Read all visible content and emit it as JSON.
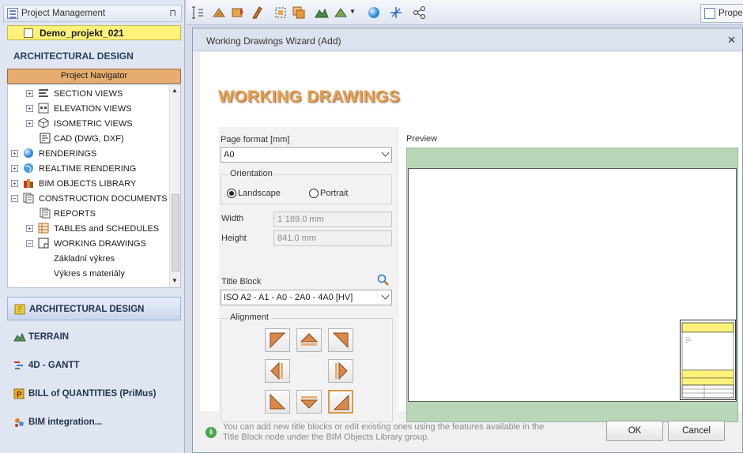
{
  "project_panel": {
    "title": "Project Management",
    "project_name": "Demo_projekt_021",
    "section_title": "ARCHITECTURAL DESIGN",
    "navigator_label": "Project Navigator",
    "tree": [
      {
        "label": "SECTION VIEWS",
        "expander": "+",
        "icon": "section-views-icon"
      },
      {
        "label": "ELEVATION VIEWS",
        "expander": "+",
        "icon": "elevation-views-icon"
      },
      {
        "label": "ISOMETRIC VIEWS",
        "expander": "+",
        "icon": "isometric-views-icon"
      },
      {
        "label": "CAD (DWG, DXF)",
        "expander": "",
        "icon": "cad-icon"
      },
      {
        "label": "RENDERINGS",
        "expander": "+",
        "icon": "sphere-icon"
      },
      {
        "label": "REALTIME RENDERING",
        "expander": "+",
        "icon": "globe-icon"
      },
      {
        "label": "BIM OBJECTS LIBRARY",
        "expander": "+",
        "icon": "books-icon"
      },
      {
        "label": "CONSTRUCTION DOCUMENTS",
        "expander": "−",
        "icon": "documents-icon"
      },
      {
        "label": "REPORTS",
        "expander": "",
        "icon": "reports-icon"
      },
      {
        "label": "TABLES and SCHEDULES",
        "expander": "+",
        "icon": "table-icon"
      },
      {
        "label": "WORKING DRAWINGS",
        "expander": "−",
        "icon": "drawing-icon"
      },
      {
        "label": "Základní výkres",
        "expander": "",
        "icon": ""
      },
      {
        "label": "Výkres s materiály",
        "expander": "",
        "icon": ""
      }
    ],
    "modules": [
      {
        "label": "ARCHITECTURAL DESIGN",
        "icon": "architecture-module-icon",
        "color": "#e8c23a"
      },
      {
        "label": "TERRAIN",
        "icon": "terrain-module-icon",
        "color": "#4b8a4b"
      },
      {
        "label": "4D - GANTT",
        "icon": "gantt-module-icon",
        "color": "#c0392b"
      },
      {
        "label": "BILL of QUANTITIES (PriMus)",
        "icon": "primus-module-icon",
        "color": "#d4a017"
      },
      {
        "label": "BIM integration...",
        "icon": "bim-integration-icon",
        "color": "#c8702a"
      }
    ]
  },
  "toolbar": {
    "properties_tab": "Proper"
  },
  "dialog": {
    "title": "Working Drawings Wizard (Add)",
    "heading": "WORKING DRAWINGS",
    "page_format_label": "Page format [mm]",
    "page_format_value": "A0",
    "orientation_label": "Orientation",
    "landscape_label": "Landscape",
    "portrait_label": "Portrait",
    "width_label": "Width",
    "width_value": "1´189.0 mm",
    "height_label": "Height",
    "height_value": "841.0 mm",
    "title_block_label": "Title Block",
    "title_block_value": "ISO  A2 - A1 - A0 - 2A0 - 4A0 [HV]",
    "alignment_label": "Alignment",
    "preview_label": "Preview",
    "info_text": "You can add new title blocks or edit existing ones using the features available in the Title Block node under the BIM Objects Library group.",
    "ok_label": "OK",
    "cancel_label": "Cancel",
    "accent_color": "#e3a258"
  }
}
